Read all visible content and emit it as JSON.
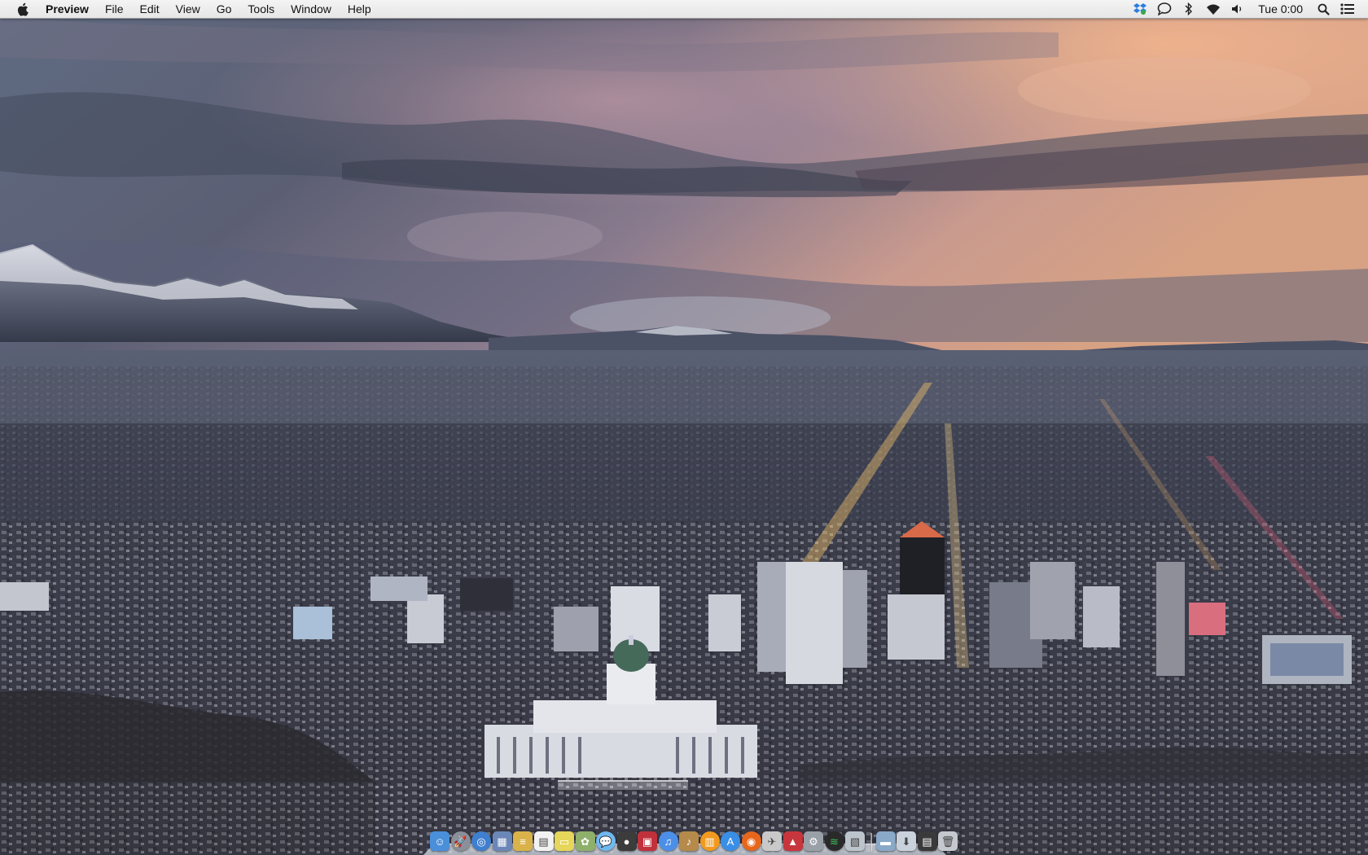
{
  "menubar": {
    "apple_icon": "apple-logo-icon",
    "app_name": "Preview",
    "menus": [
      "File",
      "Edit",
      "View",
      "Go",
      "Tools",
      "Window",
      "Help"
    ],
    "status_icons": [
      "dropbox-icon",
      "messages-icon",
      "bluetooth-icon",
      "wifi-icon",
      "volume-icon"
    ],
    "clock": "Tue 0:00",
    "spotlight_icon": "search-icon",
    "notification_icon": "notification-center-icon"
  },
  "wallpaper": {
    "subject": "city-skyline-wallpaper"
  },
  "dock": {
    "apps": [
      {
        "icon": "finder-icon",
        "color": "#4a8fd9"
      },
      {
        "icon": "launchpad-icon",
        "color": "#8b8f99"
      },
      {
        "icon": "safari-icon",
        "color": "#3f7fd0"
      },
      {
        "icon": "preview-icon",
        "color": "#6b87b8"
      },
      {
        "icon": "notes-icon",
        "color": "#d9b34a"
      },
      {
        "icon": "calendar-icon",
        "color": "#f2f2f2"
      },
      {
        "icon": "stickies-icon",
        "color": "#e6d65a"
      },
      {
        "icon": "photos-icon",
        "color": "#8fb06a"
      },
      {
        "icon": "messages-icon",
        "color": "#6fb8f0"
      },
      {
        "icon": "facetime-icon",
        "color": "#3c3c3c"
      },
      {
        "icon": "photo-booth-icon",
        "color": "#c0313c"
      },
      {
        "icon": "itunes-icon",
        "color": "#4c8fe8"
      },
      {
        "icon": "garageband-icon",
        "color": "#b58a4a"
      },
      {
        "icon": "ibooks-icon",
        "color": "#f29a1f"
      },
      {
        "icon": "app-store-icon",
        "color": "#3a8ee6"
      },
      {
        "icon": "firefox-icon",
        "color": "#e8661c"
      },
      {
        "icon": "transmit-icon",
        "color": "#c9c9c9"
      },
      {
        "icon": "cleaner-icon",
        "color": "#c8363d"
      },
      {
        "icon": "system-preferences-icon",
        "color": "#9aa0a8"
      },
      {
        "icon": "spotify-icon",
        "color": "#2a2a2a"
      },
      {
        "icon": "image-capture-icon",
        "color": "#bcc4cc"
      }
    ],
    "stacks": [
      {
        "icon": "applications-folder-icon",
        "color": "#8aa8c8"
      },
      {
        "icon": "downloads-folder-icon",
        "color": "#c9d2dc"
      },
      {
        "icon": "documents-stack-icon",
        "color": "#3a3a3a"
      },
      {
        "icon": "trash-icon",
        "color": "#c5c9cf"
      }
    ]
  }
}
